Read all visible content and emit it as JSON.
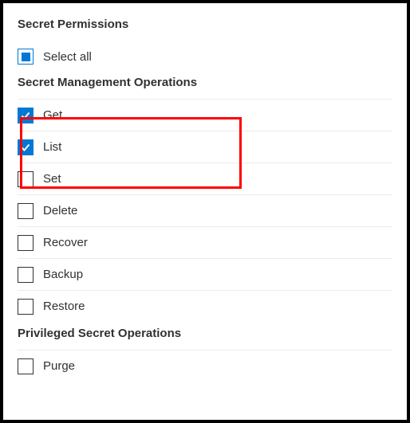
{
  "header": {
    "title": "Secret Permissions"
  },
  "selectAll": {
    "label": "Select all",
    "state": "indeterminate"
  },
  "sections": {
    "management": {
      "title": "Secret Management Operations",
      "items": [
        {
          "label": "Get",
          "checked": true
        },
        {
          "label": "List",
          "checked": true
        },
        {
          "label": "Set",
          "checked": false
        },
        {
          "label": "Delete",
          "checked": false
        },
        {
          "label": "Recover",
          "checked": false
        },
        {
          "label": "Backup",
          "checked": false
        },
        {
          "label": "Restore",
          "checked": false
        }
      ]
    },
    "privileged": {
      "title": "Privileged Secret Operations",
      "items": [
        {
          "label": "Purge",
          "checked": false
        }
      ]
    }
  },
  "colors": {
    "accent": "#0078d4",
    "highlight": "#ff0000"
  }
}
